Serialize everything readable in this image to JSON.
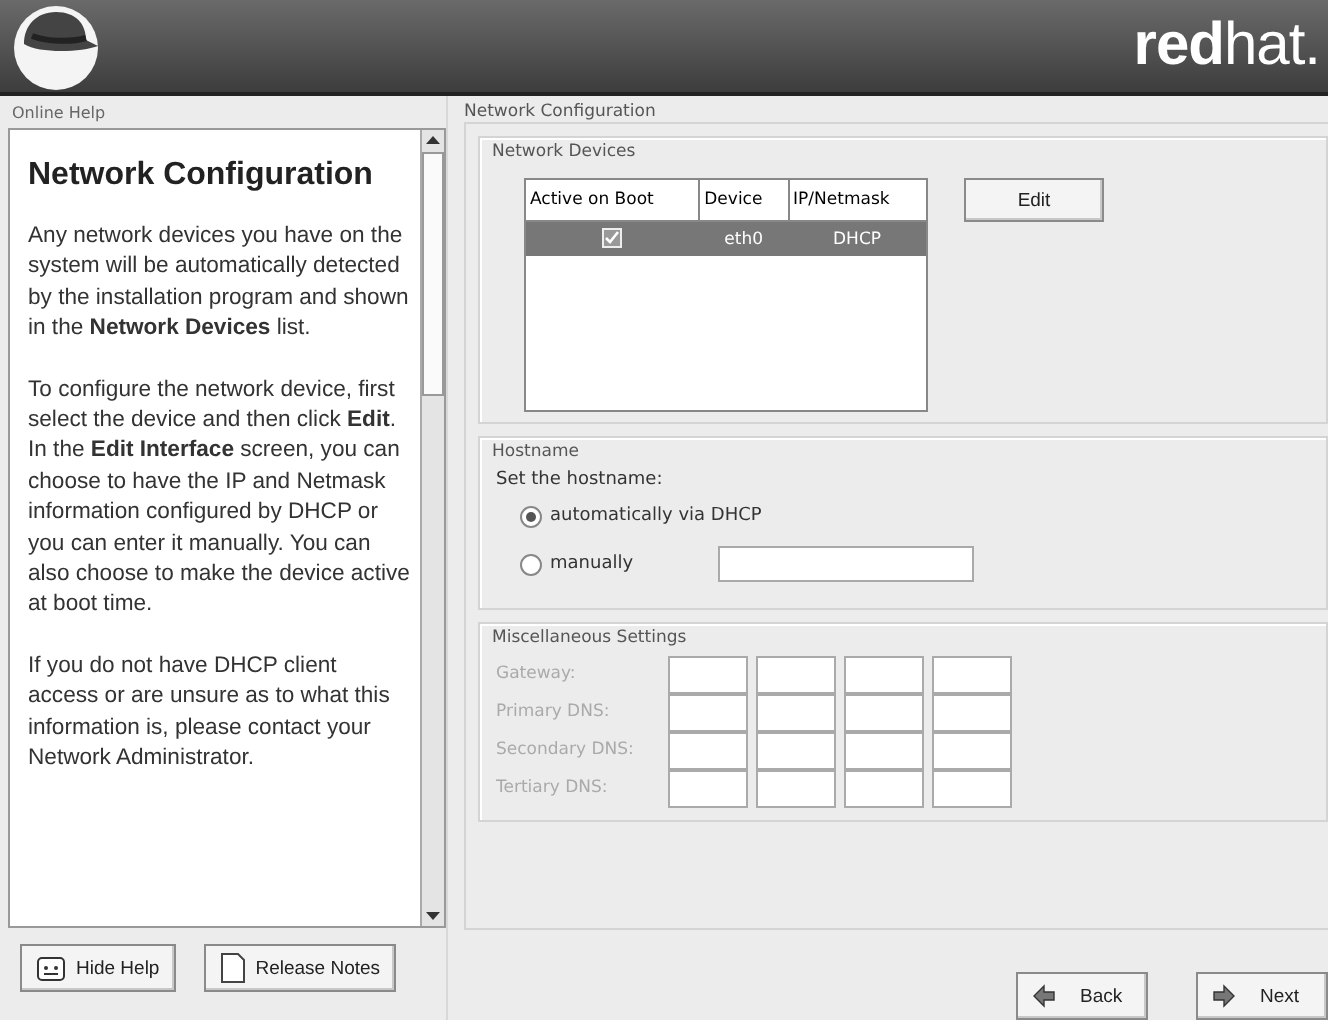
{
  "header": {
    "logo_text": "**red**hat."
  },
  "help": {
    "label": "Online Help",
    "title": "Network Configuration",
    "paragraphs": [
      "Any network devices you have on the system will be automatically detected by the installation program and shown in the **Network Devices** list.",
      "To configure the network device, first select the device and then click **Edit**. In the **Edit Interface** screen, you can choose to have the IP and Netmask information configured by DHCP or you can enter it manually. You can also choose to make the device active at boot time.",
      "If you do not have DHCP client access or are unsure as to what this information is, please contact your Network Administrator."
    ]
  },
  "config": {
    "title": "Network Configuration",
    "devices": {
      "label": "Network Devices",
      "columns": [
        "Active on Boot",
        "Device",
        "IP/Netmask"
      ],
      "rows": [
        {
          "active": true,
          "device": "eth0",
          "ip": "DHCP",
          "selected": true
        }
      ],
      "edit_button": "Edit"
    },
    "hostname": {
      "label": "Hostname",
      "prompt": "Set the hostname:",
      "options": [
        {
          "label": "automatically via DHCP",
          "selected": true,
          "kind": "auto"
        },
        {
          "label": "manually",
          "selected": false,
          "kind": "manual"
        }
      ]
    },
    "misc": {
      "label": "Miscellaneous Settings",
      "disabled": true,
      "fields": [
        "Gateway:",
        "Primary DNS:",
        "Secondary DNS:",
        "Tertiary DNS:"
      ]
    }
  },
  "buttons": [
    {
      "label": "Hide Help",
      "kind": "help"
    },
    {
      "label": "Release Notes",
      "kind": "notes"
    },
    {
      "label": "Back",
      "kind": "back"
    },
    {
      "label": "Next",
      "kind": "next"
    }
  ]
}
